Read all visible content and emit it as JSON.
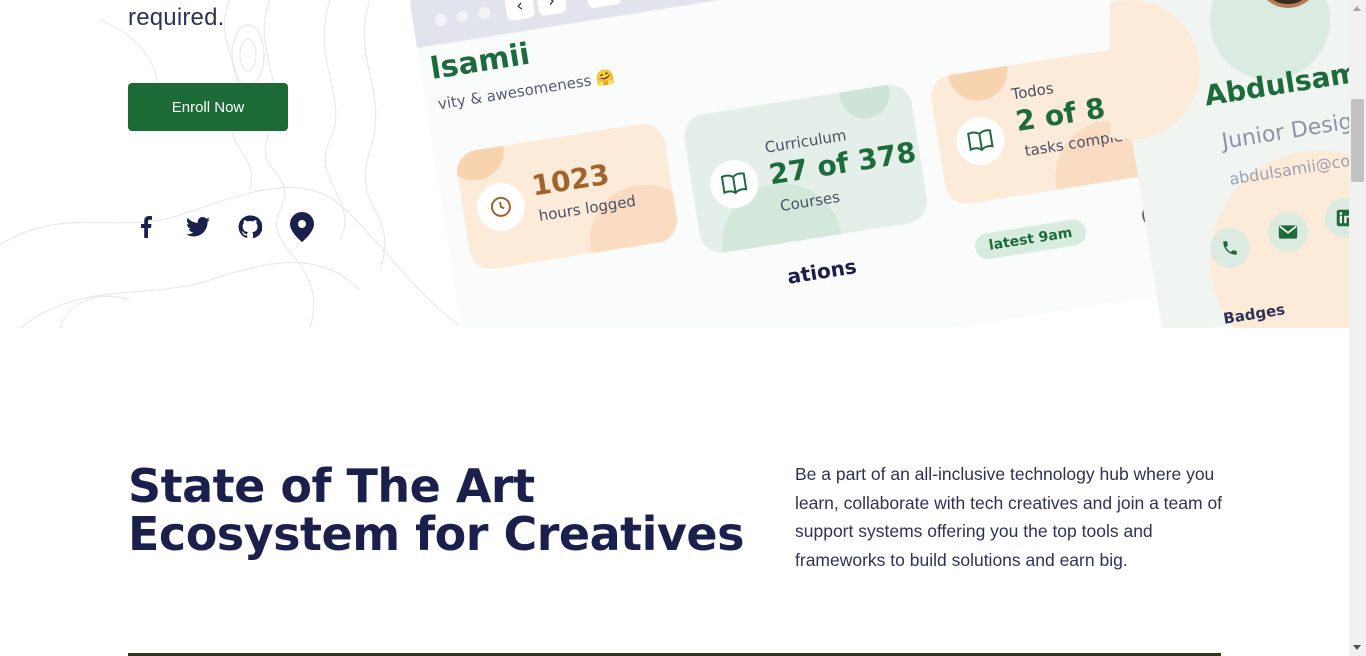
{
  "hero": {
    "text_fragment": "required.",
    "enroll_label": "Enroll Now",
    "socials": [
      "facebook-icon",
      "twitter-icon",
      "github-icon",
      "location-pin-icon"
    ]
  },
  "dashboard": {
    "greeting_name": "lsamii",
    "greeting_sub": "vity & awesomeness 🤗",
    "cards": [
      {
        "key": "",
        "value": "1023",
        "sub": "hours logged",
        "icon": "clock-icon",
        "bg": "#fdebd9",
        "accent": "#a1632c"
      },
      {
        "key": "Curriculum",
        "value": "27 of 378",
        "sub": "Courses",
        "icon": "book-icon",
        "bg": "#e3efe8",
        "accent": "#1d6b3b"
      },
      {
        "key": "Todos",
        "value": "2 of 8",
        "sub": "tasks completed",
        "icon": "book-icon",
        "bg": "#fdebd9",
        "accent": "#1d6b3b"
      }
    ],
    "notifications_title": "ations",
    "latest_pill": "latest 9am"
  },
  "profile": {
    "name": "Abdulsamii",
    "role": "Junior Desig",
    "email": "abdulsamii@co",
    "badges_label": "Badges"
  },
  "section": {
    "title_line1": "State of The Art",
    "title_line2": "Ecosystem for Creatives",
    "description": "Be a part of an all-inclusive technology hub where you learn, collaborate with tech creatives and join a team of support systems offering you the top tools and frameworks to build solutions and earn big."
  },
  "colors": {
    "brand_green": "#1c6b37",
    "navy": "#1b1f4b",
    "peach": "#fdebd9",
    "mint": "#e3efe8"
  }
}
